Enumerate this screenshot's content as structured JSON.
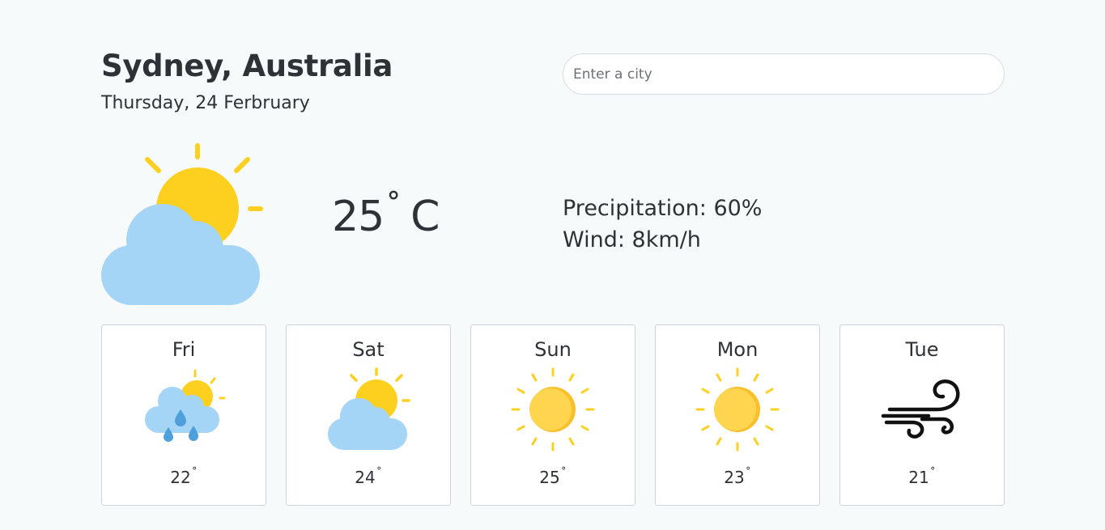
{
  "location": {
    "city": "Sydney, Australia",
    "date": "Thursday, 24 Ferbruary"
  },
  "search": {
    "placeholder": "Enter a city"
  },
  "current": {
    "temperature": "25",
    "degree_symbol": "˚",
    "unit": "C",
    "icon": "sun-behind-cloud-icon",
    "precipitation": "Precipitation: 60%",
    "wind": "Wind: 8km/h"
  },
  "forecast": [
    {
      "day": "Fri",
      "temp": "22",
      "degree_symbol": "˚",
      "icon": "sun-cloud-rain-icon"
    },
    {
      "day": "Sat",
      "temp": "24",
      "degree_symbol": "˚",
      "icon": "sun-behind-cloud-icon"
    },
    {
      "day": "Sun",
      "temp": "25",
      "degree_symbol": "˚",
      "icon": "sun-icon"
    },
    {
      "day": "Mon",
      "temp": "23",
      "degree_symbol": "˚",
      "icon": "sun-icon"
    },
    {
      "day": "Tue",
      "temp": "21",
      "degree_symbol": "˚",
      "icon": "wind-icon"
    }
  ],
  "colors": {
    "background": "#f7fafb",
    "sun": "#fdd020",
    "sun_light": "#ffd54f",
    "sun_shadow": "#f9c02b",
    "cloud": "#a4d4f6",
    "rain": "#4ea0dc",
    "text": "#2e3237"
  }
}
